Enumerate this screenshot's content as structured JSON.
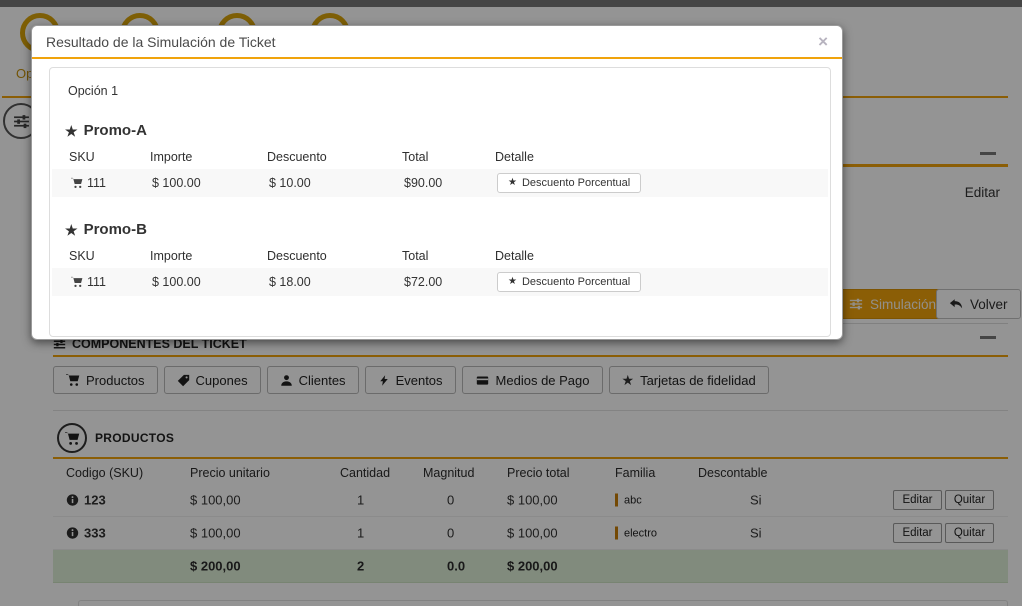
{
  "colors": {
    "accent": "#f0a30c",
    "success_row_bg": "#dff0d8",
    "wizard_gold": "#d9a40b"
  },
  "icons": {
    "star": "★"
  },
  "modal": {
    "title": "Resultado de la Simulación de Ticket",
    "close_label": "×",
    "option_label": "Opción 1",
    "columns": [
      "SKU",
      "Importe",
      "Descuento",
      "Total",
      "Detalle"
    ],
    "promos": [
      {
        "name": "Promo-A",
        "rows": [
          {
            "sku": "111",
            "importe": "$ 100.00",
            "descuento": "$ 10.00",
            "total": "$90.00",
            "detalle": "Descuento Porcentual"
          }
        ]
      },
      {
        "name": "Promo-B",
        "rows": [
          {
            "sku": "111",
            "importe": "$ 100.00",
            "descuento": "$ 18.00",
            "total": "$72.00",
            "detalle": "Descuento Porcentual"
          }
        ]
      }
    ]
  },
  "background": {
    "wizard_label": "Opciones",
    "edit_link": "Editar",
    "simulation_button": "Simulación",
    "back_button": "Volver",
    "components_title": "COMPONENTES DEL TICKET",
    "tabs": [
      "Productos",
      "Cupones",
      "Clientes",
      "Eventos",
      "Medios de Pago",
      "Tarjetas de fidelidad"
    ],
    "products": {
      "title": "PRODUCTOS",
      "columns": [
        "Codigo (SKU)",
        "Precio unitario",
        "Cantidad",
        "Magnitud",
        "Precio total",
        "Familia",
        "Descontable"
      ],
      "rows": [
        {
          "sku": "123",
          "unit_price": "$ 100,00",
          "quantity": "1",
          "magnitude": "0",
          "total_price": "$ 100,00",
          "family": "abc",
          "discountable": "Si"
        },
        {
          "sku": "333",
          "unit_price": "$ 100,00",
          "quantity": "1",
          "magnitude": "0",
          "total_price": "$ 100,00",
          "family": "electro",
          "discountable": "Si"
        }
      ],
      "totals": {
        "unit_price": "$ 200,00",
        "quantity": "2",
        "magnitude": "0.0",
        "total_price": "$ 200,00"
      },
      "edit_button": "Editar",
      "remove_button": "Quitar"
    }
  }
}
